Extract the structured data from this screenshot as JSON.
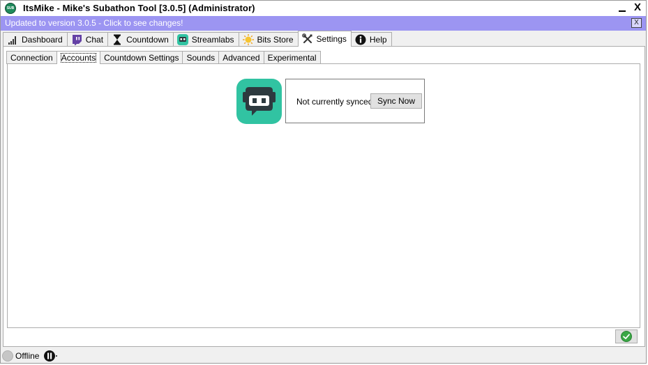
{
  "window": {
    "title": "ItsMike - Mike's Subathon Tool [3.0.5] (Administrator)",
    "app_icon_text": "SUB",
    "minimize_label": "",
    "close_label": "X"
  },
  "banner": {
    "text": "Updated to version 3.0.5 - Click to see changes!",
    "close_label": "X",
    "color": "#9c95f2"
  },
  "main_tabs": [
    {
      "label": "Dashboard",
      "icon": "bar-chart-icon"
    },
    {
      "label": "Chat",
      "icon": "twitch-icon"
    },
    {
      "label": "Countdown",
      "icon": "hourglass-icon"
    },
    {
      "label": "Streamlabs",
      "icon": "streamlabs-icon"
    },
    {
      "label": "Bits Store",
      "icon": "bits-icon"
    },
    {
      "label": "Settings",
      "icon": "tools-icon",
      "active": true
    },
    {
      "label": "Help",
      "icon": "info-icon"
    }
  ],
  "sub_tabs": [
    {
      "label": "Connection"
    },
    {
      "label": "Accounts",
      "active": true
    },
    {
      "label": "Countdown Settings"
    },
    {
      "label": "Sounds"
    },
    {
      "label": "Advanced"
    },
    {
      "label": "Experimental"
    }
  ],
  "streamlabs": {
    "logo_icon": "streamlabs-logo-icon",
    "status": "Not currently synced",
    "sync_button": "Sync Now",
    "brand_color": "#31c3a2"
  },
  "footer": {
    "ok_icon": "check-icon",
    "status_text": "Offline",
    "pause_icon": "pause-icon"
  }
}
